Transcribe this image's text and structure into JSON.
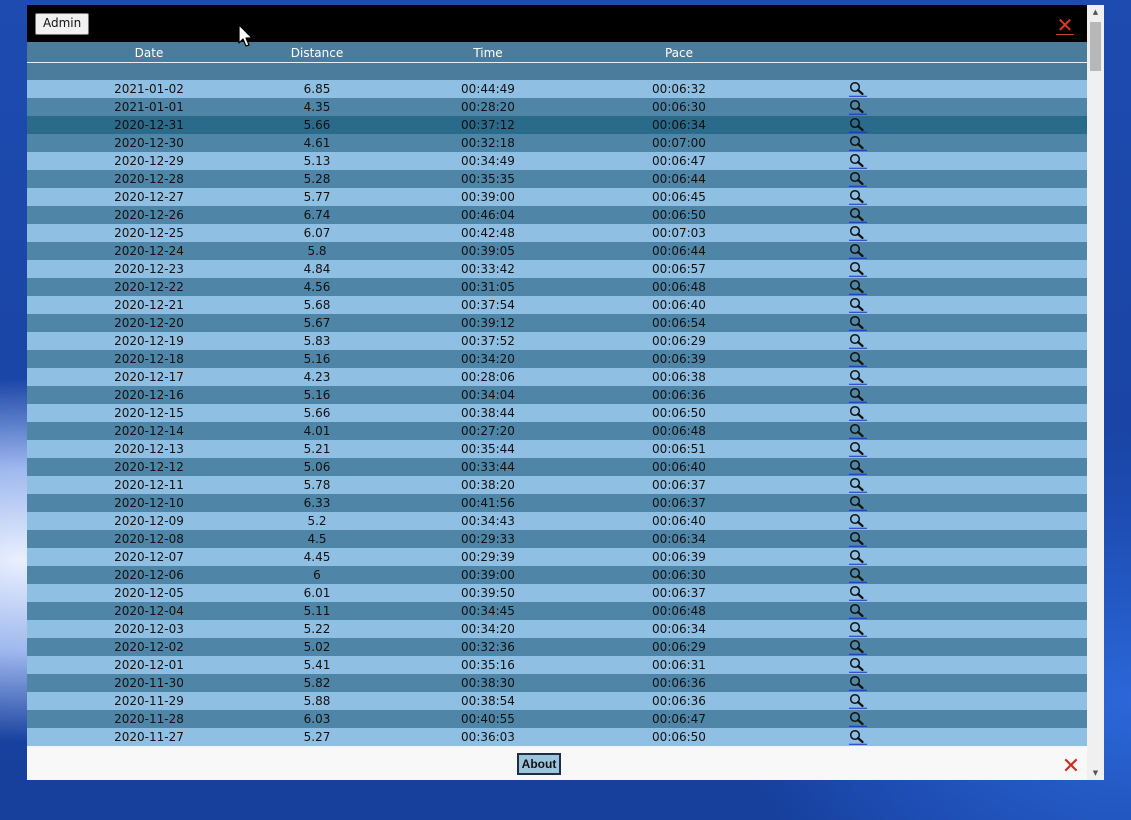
{
  "toolbar": {
    "admin_label": "Admin",
    "close_icon": "close-x-icon"
  },
  "table": {
    "columns": [
      "Date",
      "Distance",
      "Time",
      "Pace"
    ],
    "rows": [
      [
        "2021-01-02",
        "6.85",
        "00:44:49",
        "00:06:32"
      ],
      [
        "2021-01-01",
        "4.35",
        "00:28:20",
        "00:06:30"
      ],
      [
        "2020-12-31",
        "5.66",
        "00:37:12",
        "00:06:34"
      ],
      [
        "2020-12-30",
        "4.61",
        "00:32:18",
        "00:07:00"
      ],
      [
        "2020-12-29",
        "5.13",
        "00:34:49",
        "00:06:47"
      ],
      [
        "2020-12-28",
        "5.28",
        "00:35:35",
        "00:06:44"
      ],
      [
        "2020-12-27",
        "5.77",
        "00:39:00",
        "00:06:45"
      ],
      [
        "2020-12-26",
        "6.74",
        "00:46:04",
        "00:06:50"
      ],
      [
        "2020-12-25",
        "6.07",
        "00:42:48",
        "00:07:03"
      ],
      [
        "2020-12-24",
        "5.8",
        "00:39:05",
        "00:06:44"
      ],
      [
        "2020-12-23",
        "4.84",
        "00:33:42",
        "00:06:57"
      ],
      [
        "2020-12-22",
        "4.56",
        "00:31:05",
        "00:06:48"
      ],
      [
        "2020-12-21",
        "5.68",
        "00:37:54",
        "00:06:40"
      ],
      [
        "2020-12-20",
        "5.67",
        "00:39:12",
        "00:06:54"
      ],
      [
        "2020-12-19",
        "5.83",
        "00:37:52",
        "00:06:29"
      ],
      [
        "2020-12-18",
        "5.16",
        "00:34:20",
        "00:06:39"
      ],
      [
        "2020-12-17",
        "4.23",
        "00:28:06",
        "00:06:38"
      ],
      [
        "2020-12-16",
        "5.16",
        "00:34:04",
        "00:06:36"
      ],
      [
        "2020-12-15",
        "5.66",
        "00:38:44",
        "00:06:50"
      ],
      [
        "2020-12-14",
        "4.01",
        "00:27:20",
        "00:06:48"
      ],
      [
        "2020-12-13",
        "5.21",
        "00:35:44",
        "00:06:51"
      ],
      [
        "2020-12-12",
        "5.06",
        "00:33:44",
        "00:06:40"
      ],
      [
        "2020-12-11",
        "5.78",
        "00:38:20",
        "00:06:37"
      ],
      [
        "2020-12-10",
        "6.33",
        "00:41:56",
        "00:06:37"
      ],
      [
        "2020-12-09",
        "5.2",
        "00:34:43",
        "00:06:40"
      ],
      [
        "2020-12-08",
        "4.5",
        "00:29:33",
        "00:06:34"
      ],
      [
        "2020-12-07",
        "4.45",
        "00:29:39",
        "00:06:39"
      ],
      [
        "2020-12-06",
        "6",
        "00:39:00",
        "00:06:30"
      ],
      [
        "2020-12-05",
        "6.01",
        "00:39:50",
        "00:06:37"
      ],
      [
        "2020-12-04",
        "5.11",
        "00:34:45",
        "00:06:48"
      ],
      [
        "2020-12-03",
        "5.22",
        "00:34:20",
        "00:06:34"
      ],
      [
        "2020-12-02",
        "5.02",
        "00:32:36",
        "00:06:29"
      ],
      [
        "2020-12-01",
        "5.41",
        "00:35:16",
        "00:06:31"
      ],
      [
        "2020-11-30",
        "5.82",
        "00:38:30",
        "00:06:36"
      ],
      [
        "2020-11-29",
        "5.88",
        "00:38:54",
        "00:06:36"
      ],
      [
        "2020-11-28",
        "6.03",
        "00:40:55",
        "00:06:47"
      ],
      [
        "2020-11-27",
        "5.27",
        "00:36:03",
        "00:06:50"
      ]
    ],
    "row_action_icon": "magnifier-icon",
    "highlighted_row": "2020-12-31"
  },
  "footer": {
    "about_label": "About",
    "close_icon": "close-x-icon"
  },
  "colors": {
    "row_light": "#8fc0e4",
    "row_dark": "#4f86a8",
    "row_highlight": "#2a6b8c",
    "header": "#4c7c9c",
    "close_red": "#e03a1c"
  }
}
